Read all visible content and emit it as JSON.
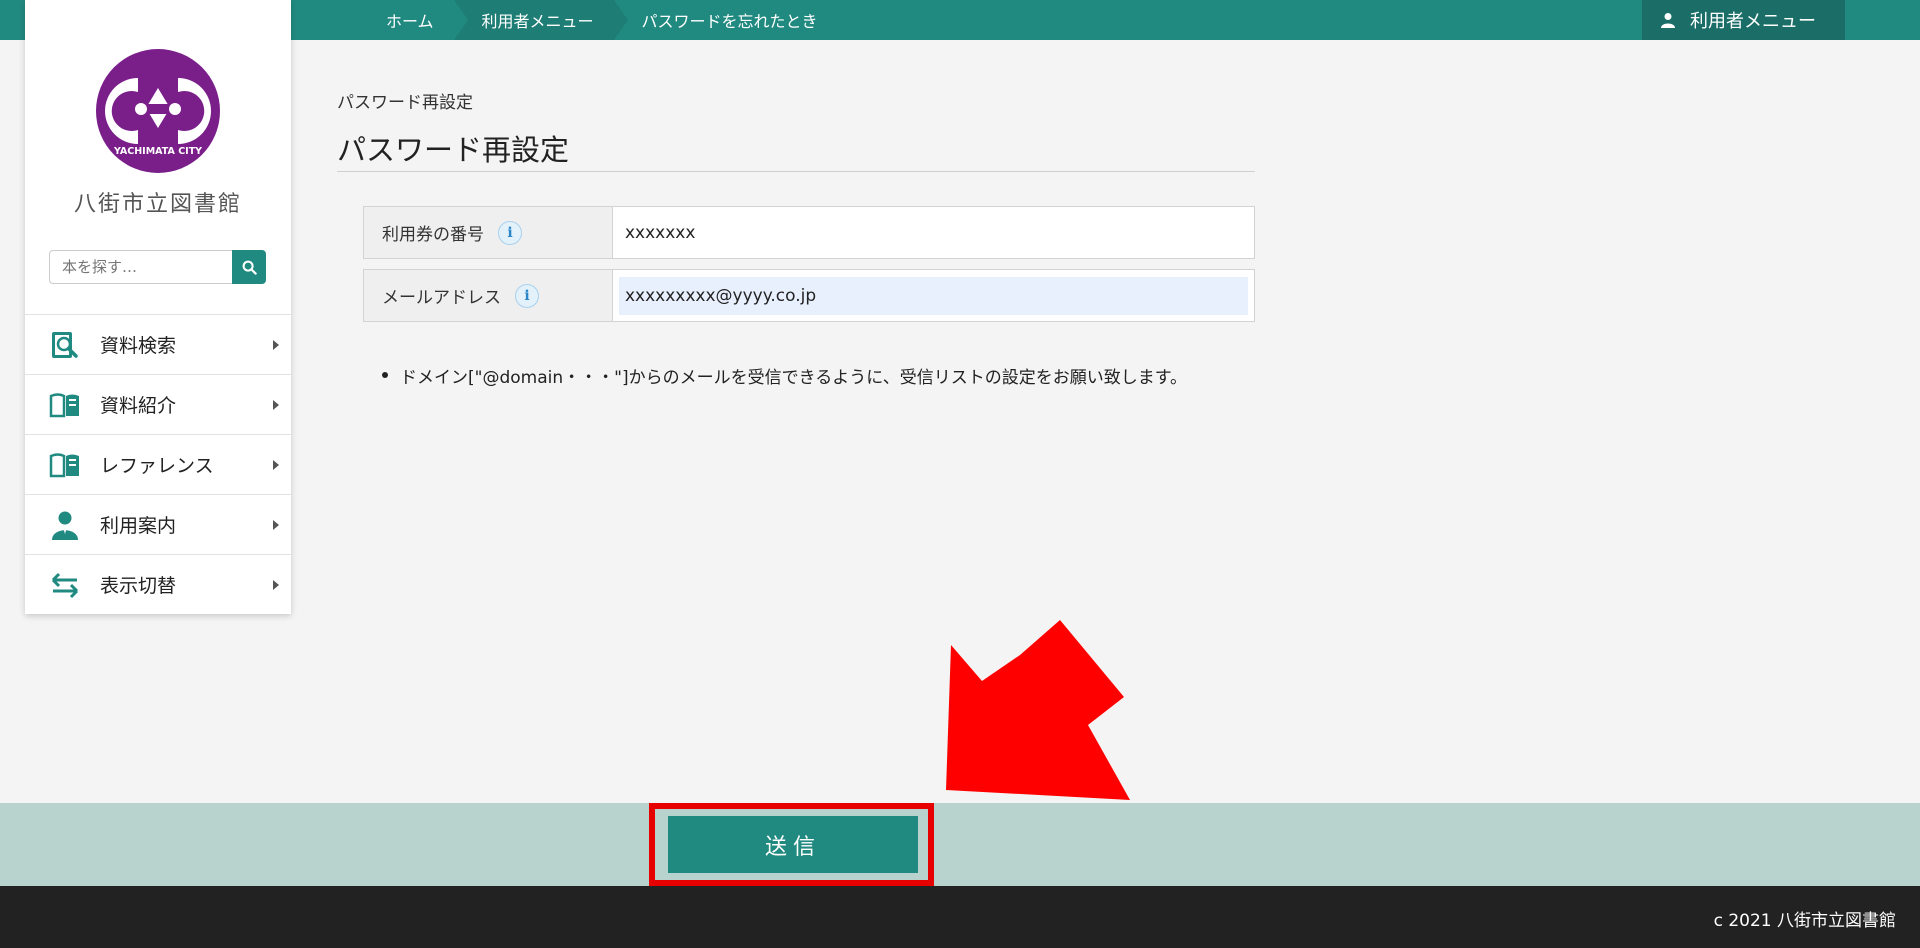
{
  "breadcrumb": {
    "items": [
      "ホーム",
      "利用者メニュー",
      "パスワードを忘れたとき"
    ]
  },
  "header": {
    "user_menu_label": "利用者メニュー"
  },
  "sidebar": {
    "logo_text": "YACHIMATA CITY",
    "library_name": "八街市立図書館",
    "search": {
      "placeholder": "本を探す…"
    },
    "items": [
      {
        "label": "資料検索",
        "icon": "book-search-icon"
      },
      {
        "label": "資料紹介",
        "icon": "open-book-icon"
      },
      {
        "label": "レファレンス",
        "icon": "open-book-icon"
      },
      {
        "label": "利用案内",
        "icon": "person-icon"
      },
      {
        "label": "表示切替",
        "icon": "swap-arrows-icon"
      }
    ]
  },
  "main": {
    "small_title": "パスワード再設定",
    "title": "パスワード再設定",
    "fields": [
      {
        "label": "利用券の番号",
        "value": "xxxxxxx"
      },
      {
        "label": "メールアドレス",
        "value": "xxxxxxxxx@yyyy.co.jp"
      }
    ],
    "notice": "ドメイン[\"@domain・・・\"]からのメールを受信できるように、受信リストの設定をお願い致します。"
  },
  "submit": {
    "label": "送信"
  },
  "footer": {
    "copyright": "c 2021 八街市立図書館"
  },
  "colors": {
    "brand": "#218a80",
    "highlight": "#e60000",
    "logo_purple": "#7a1f8a"
  }
}
